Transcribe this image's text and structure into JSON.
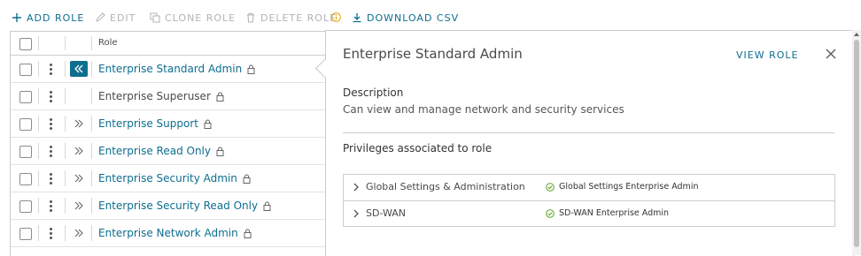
{
  "toolbar": {
    "add_role": "ADD ROLE",
    "edit": "EDIT",
    "clone_role": "CLONE ROLE",
    "delete_role": "DELETE ROLE",
    "download_csv": "DOWNLOAD CSV"
  },
  "grid": {
    "column_role": "Role",
    "rows": [
      {
        "name": "Enterprise Standard Admin",
        "linked": true,
        "expanded": true
      },
      {
        "name": "Enterprise Superuser",
        "linked": false,
        "expanded": false
      },
      {
        "name": "Enterprise Support",
        "linked": true,
        "expanded": false
      },
      {
        "name": "Enterprise Read Only",
        "linked": true,
        "expanded": false
      },
      {
        "name": "Enterprise Security Admin",
        "linked": true,
        "expanded": false
      },
      {
        "name": "Enterprise Security Read Only",
        "linked": true,
        "expanded": false
      },
      {
        "name": "Enterprise Network Admin",
        "linked": true,
        "expanded": false
      }
    ]
  },
  "detail": {
    "title": "Enterprise Standard Admin",
    "view_role": "VIEW ROLE",
    "description_label": "Description",
    "description": "Can view and manage network and security services",
    "privileges_label": "Privileges associated to role",
    "privileges": [
      {
        "category": "Global Settings & Administration",
        "privilege": "Global Settings Enterprise Admin"
      },
      {
        "category": "SD-WAN",
        "privilege": "SD-WAN Enterprise Admin"
      }
    ]
  },
  "colors": {
    "accent": "#0d6e8f",
    "disabled": "#b3b3b3",
    "success": "#5aa220",
    "warning": "#e5a100"
  }
}
